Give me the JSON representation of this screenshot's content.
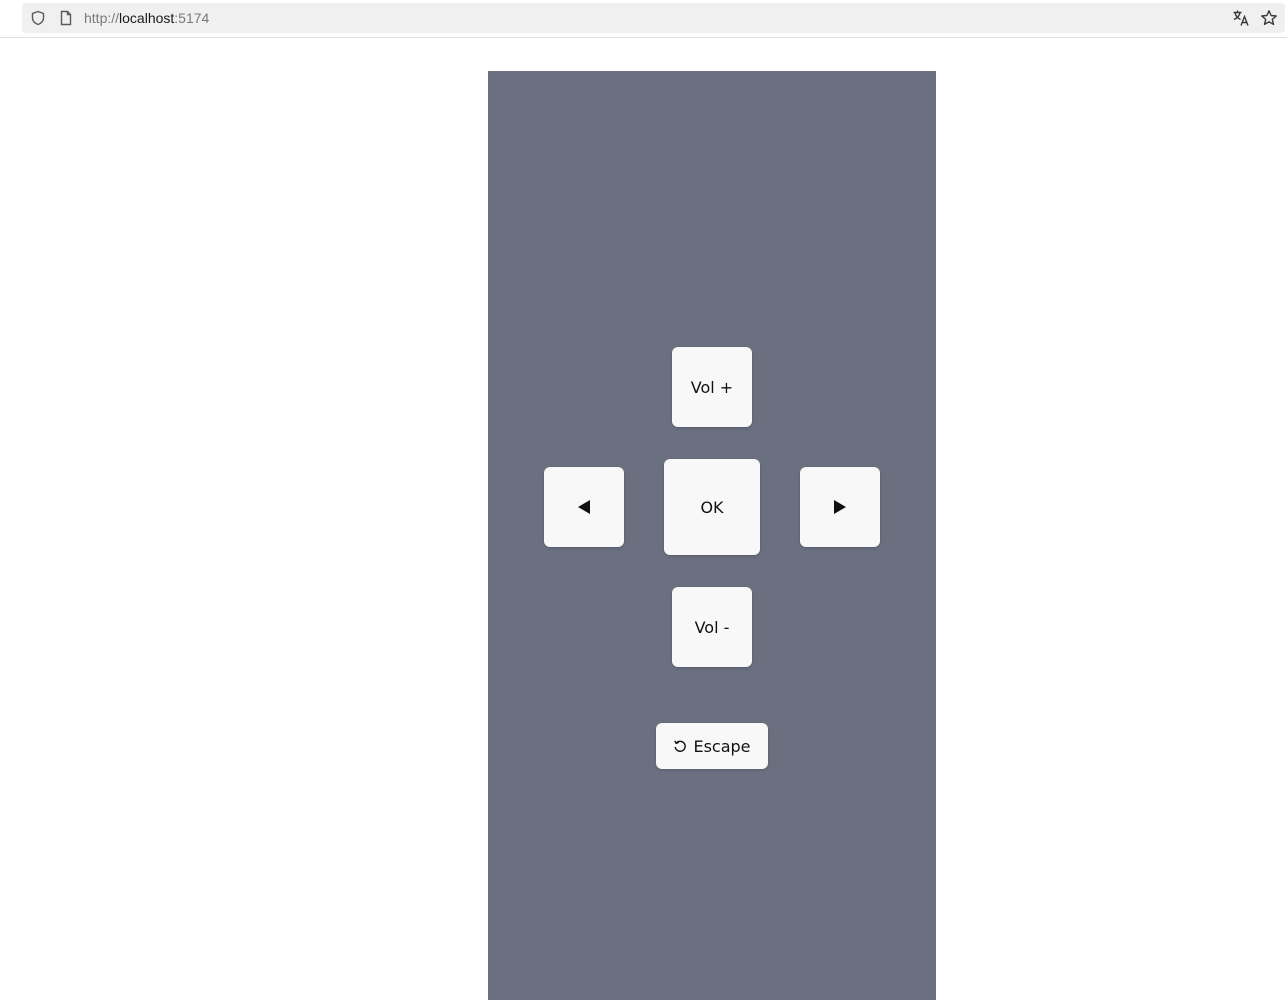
{
  "browser": {
    "url_scheme": "http://",
    "url_host": "localhost",
    "url_port": ":5174"
  },
  "remote": {
    "panel_color": "#6b7080",
    "vol_up_label": "Vol +",
    "ok_label": "OK",
    "vol_down_label": "Vol -",
    "escape_label": "Escape",
    "left_icon": "left-triangle",
    "right_icon": "right-triangle",
    "escape_icon": "reset-arrow"
  }
}
